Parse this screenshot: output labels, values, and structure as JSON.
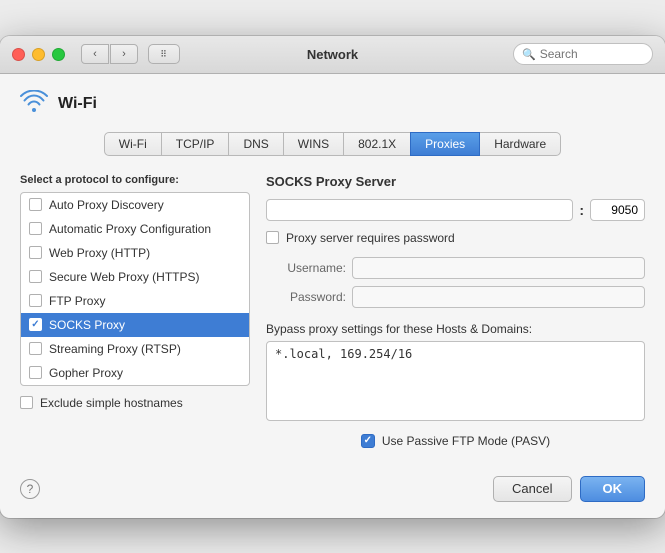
{
  "titlebar": {
    "title": "Network",
    "search_placeholder": "Search"
  },
  "wifi_section": {
    "label": "Wi-Fi"
  },
  "tabs": [
    {
      "id": "wifi",
      "label": "Wi-Fi",
      "active": false
    },
    {
      "id": "tcpip",
      "label": "TCP/IP",
      "active": false
    },
    {
      "id": "dns",
      "label": "DNS",
      "active": false
    },
    {
      "id": "wins",
      "label": "WINS",
      "active": false
    },
    {
      "id": "8021x",
      "label": "802.1X",
      "active": false
    },
    {
      "id": "proxies",
      "label": "Proxies",
      "active": true
    },
    {
      "id": "hardware",
      "label": "Hardware",
      "active": false
    }
  ],
  "protocol_section": {
    "label": "Select a protocol to configure:",
    "items": [
      {
        "id": "auto-proxy",
        "label": "Auto Proxy Discovery",
        "checked": false,
        "selected": false
      },
      {
        "id": "auto-proxy-config",
        "label": "Automatic Proxy Configuration",
        "checked": false,
        "selected": false
      },
      {
        "id": "web-proxy",
        "label": "Web Proxy (HTTP)",
        "checked": false,
        "selected": false
      },
      {
        "id": "secure-web-proxy",
        "label": "Secure Web Proxy (HTTPS)",
        "checked": false,
        "selected": false
      },
      {
        "id": "ftp-proxy",
        "label": "FTP Proxy",
        "checked": false,
        "selected": false
      },
      {
        "id": "socks-proxy",
        "label": "SOCKS Proxy",
        "checked": true,
        "selected": true
      },
      {
        "id": "streaming-proxy",
        "label": "Streaming Proxy (RTSP)",
        "checked": false,
        "selected": false
      },
      {
        "id": "gopher-proxy",
        "label": "Gopher Proxy",
        "checked": false,
        "selected": false
      }
    ]
  },
  "exclude_row": {
    "label": "Exclude simple hostnames",
    "checked": false
  },
  "socks_panel": {
    "title": "SOCKS Proxy Server",
    "port_value": "9050",
    "password_req_label": "Proxy server requires password",
    "password_req_checked": false,
    "username_label": "Username:",
    "password_label": "Password:"
  },
  "bypass_section": {
    "label": "Bypass proxy settings for these Hosts & Domains:",
    "value": "*.local, 169.254/16"
  },
  "passive_ftp": {
    "label": "Use Passive FTP Mode (PASV)",
    "checked": true
  },
  "buttons": {
    "cancel": "Cancel",
    "ok": "OK"
  }
}
